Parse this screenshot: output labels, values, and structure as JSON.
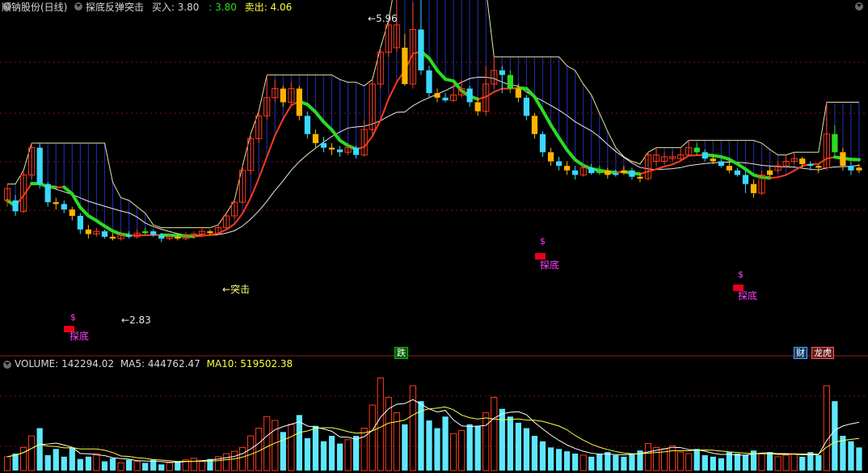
{
  "header": {
    "stock_name": "顺钠股份(日线)",
    "indicator_name": "探底反弹突击",
    "buy_label": "买入:",
    "buy_value": "3.80",
    "buy_value2": ": 3.80",
    "sell_label": "卖出:",
    "sell_value": "4.06"
  },
  "volume_header": {
    "volume_text": "VOLUME: 142294.02",
    "ma5_text": "MA5: 444762.47",
    "ma10_text": "MA10: 519502.38"
  },
  "annotations": {
    "high": "5.96",
    "low": "2.83",
    "breakout": "突击",
    "dip_marker": "$",
    "dip_label": "探底"
  },
  "event_badges": [
    {
      "text": "跌",
      "color": "#00c000"
    },
    {
      "text": "财",
      "color": "#4fa8ff"
    },
    {
      "text": "龙虎",
      "color": "#ff5a5a"
    }
  ],
  "colors": {
    "up": "#ff3a1a",
    "down": "#3ad8ff",
    "yellow_candle": "#ffb400",
    "green_line": "#2adc22",
    "red_line": "#ff3a1a",
    "white_line": "#e8e8e8",
    "band_line": "#e6e6a0",
    "blue_fill": "#1a2aa0",
    "grid": "#7a1a1a",
    "ma5": "#ffffff",
    "ma10": "#ffff40"
  },
  "chart_data": {
    "type": "candlestick",
    "price_range": [
      2.5,
      6.2
    ],
    "candles": [
      [
        4.25,
        4.12,
        4.3,
        4.05,
        "u"
      ],
      [
        4.12,
        4.0,
        4.18,
        3.95,
        "d"
      ],
      [
        4.0,
        4.4,
        4.45,
        3.98,
        "u"
      ],
      [
        4.4,
        4.7,
        4.75,
        4.35,
        "u"
      ],
      [
        4.7,
        4.3,
        4.75,
        4.25,
        "d"
      ],
      [
        4.3,
        4.1,
        4.32,
        4.05,
        "d"
      ],
      [
        4.1,
        4.08,
        4.15,
        4.02,
        "y"
      ],
      [
        4.08,
        4.02,
        4.12,
        3.98,
        "d"
      ],
      [
        4.02,
        3.95,
        4.05,
        3.9,
        "y"
      ],
      [
        3.95,
        3.8,
        3.98,
        3.75,
        "d"
      ],
      [
        3.8,
        3.75,
        3.85,
        3.7,
        "y"
      ],
      [
        3.75,
        3.78,
        3.82,
        3.72,
        "u"
      ],
      [
        3.78,
        3.72,
        3.8,
        3.7,
        "d"
      ],
      [
        3.72,
        3.7,
        3.76,
        3.68,
        "y"
      ],
      [
        3.7,
        3.74,
        3.78,
        3.68,
        "u"
      ],
      [
        3.74,
        3.72,
        3.78,
        3.7,
        "d"
      ],
      [
        3.72,
        3.76,
        3.8,
        3.7,
        "u"
      ],
      [
        3.76,
        3.78,
        3.82,
        3.74,
        "g"
      ],
      [
        3.78,
        3.74,
        3.8,
        3.72,
        "d"
      ],
      [
        3.74,
        3.7,
        3.76,
        3.66,
        "d"
      ],
      [
        3.7,
        3.72,
        3.76,
        3.68,
        "u"
      ],
      [
        3.72,
        3.7,
        3.75,
        3.68,
        "y"
      ],
      [
        3.7,
        3.73,
        3.77,
        3.68,
        "u"
      ],
      [
        3.73,
        3.75,
        3.78,
        3.7,
        "u"
      ],
      [
        3.75,
        3.78,
        3.82,
        3.74,
        "u"
      ],
      [
        3.78,
        3.76,
        3.8,
        3.74,
        "y"
      ],
      [
        3.76,
        3.82,
        3.85,
        3.74,
        "u"
      ],
      [
        3.82,
        3.95,
        3.98,
        3.8,
        "u"
      ],
      [
        3.95,
        4.1,
        4.12,
        3.92,
        "u"
      ],
      [
        4.1,
        4.45,
        4.5,
        4.08,
        "u"
      ],
      [
        4.45,
        4.8,
        4.85,
        4.4,
        "u"
      ],
      [
        4.8,
        5.05,
        5.1,
        4.75,
        "u"
      ],
      [
        5.05,
        5.25,
        5.5,
        5.0,
        "u"
      ],
      [
        5.25,
        5.35,
        5.45,
        5.2,
        "u"
      ],
      [
        5.35,
        5.2,
        5.38,
        5.15,
        "y"
      ],
      [
        5.2,
        5.35,
        5.42,
        5.15,
        "u"
      ],
      [
        5.35,
        5.05,
        5.38,
        5.0,
        "y"
      ],
      [
        5.05,
        4.85,
        5.1,
        4.8,
        "d"
      ],
      [
        4.85,
        4.75,
        4.9,
        4.7,
        "y"
      ],
      [
        4.75,
        4.7,
        4.82,
        4.65,
        "d"
      ],
      [
        4.7,
        4.68,
        4.75,
        4.62,
        "y"
      ],
      [
        4.68,
        4.65,
        4.72,
        4.6,
        "d"
      ],
      [
        4.65,
        4.7,
        4.75,
        4.62,
        "u"
      ],
      [
        4.7,
        4.62,
        4.72,
        4.58,
        "d"
      ],
      [
        4.62,
        4.9,
        5.0,
        4.6,
        "u"
      ],
      [
        4.9,
        5.4,
        5.45,
        4.85,
        "u"
      ],
      [
        5.4,
        5.75,
        5.8,
        5.35,
        "u"
      ],
      [
        5.75,
        6.05,
        6.1,
        5.7,
        "u"
      ],
      [
        6.05,
        5.8,
        6.6,
        5.75,
        "u"
      ],
      [
        5.8,
        5.4,
        5.95,
        5.38,
        "y"
      ],
      [
        5.4,
        6.0,
        6.3,
        5.35,
        "u"
      ],
      [
        6.0,
        5.55,
        6.45,
        5.5,
        "d"
      ],
      [
        5.55,
        5.3,
        5.6,
        5.25,
        "d"
      ],
      [
        5.3,
        5.25,
        5.35,
        5.2,
        "y"
      ],
      [
        5.25,
        5.22,
        5.3,
        5.2,
        "d"
      ],
      [
        5.22,
        5.28,
        5.4,
        5.2,
        "u"
      ],
      [
        5.28,
        5.35,
        5.45,
        5.25,
        "u"
      ],
      [
        5.35,
        5.2,
        5.38,
        5.15,
        "d"
      ],
      [
        5.2,
        5.1,
        5.25,
        5.05,
        "y"
      ],
      [
        5.1,
        5.4,
        5.6,
        5.05,
        "u"
      ],
      [
        5.4,
        5.55,
        5.7,
        5.35,
        "u"
      ],
      [
        5.55,
        5.5,
        5.6,
        5.3,
        "d"
      ],
      [
        5.5,
        5.35,
        5.55,
        5.3,
        "g"
      ],
      [
        5.35,
        5.25,
        5.4,
        5.2,
        "y"
      ],
      [
        5.25,
        5.05,
        5.28,
        5.0,
        "d"
      ],
      [
        5.05,
        4.85,
        5.08,
        4.8,
        "y"
      ],
      [
        4.85,
        4.65,
        4.88,
        4.6,
        "d"
      ],
      [
        4.65,
        4.55,
        4.7,
        4.5,
        "y"
      ],
      [
        4.55,
        4.5,
        4.6,
        4.45,
        "d"
      ],
      [
        4.5,
        4.45,
        4.55,
        4.4,
        "y"
      ],
      [
        4.45,
        4.4,
        4.5,
        4.35,
        "d"
      ],
      [
        4.4,
        4.48,
        4.52,
        4.38,
        "u"
      ],
      [
        4.48,
        4.42,
        4.52,
        4.4,
        "d"
      ],
      [
        4.42,
        4.45,
        4.5,
        4.4,
        "g"
      ],
      [
        4.45,
        4.4,
        4.48,
        4.36,
        "y"
      ],
      [
        4.4,
        4.42,
        4.46,
        4.38,
        "d"
      ],
      [
        4.42,
        4.45,
        4.5,
        4.4,
        "y"
      ],
      [
        4.45,
        4.38,
        4.48,
        4.35,
        "d"
      ],
      [
        4.38,
        4.36,
        4.42,
        4.32,
        "y"
      ],
      [
        4.36,
        4.62,
        4.65,
        4.34,
        "u"
      ],
      [
        4.62,
        4.55,
        4.7,
        4.5,
        "u"
      ],
      [
        4.55,
        4.6,
        4.65,
        4.52,
        "u"
      ],
      [
        4.6,
        4.58,
        4.66,
        4.55,
        "u"
      ],
      [
        4.58,
        4.62,
        4.7,
        4.56,
        "u"
      ],
      [
        4.62,
        4.7,
        4.78,
        4.6,
        "u"
      ],
      [
        4.7,
        4.65,
        4.75,
        4.62,
        "g"
      ],
      [
        4.65,
        4.58,
        4.68,
        4.55,
        "d"
      ],
      [
        4.58,
        4.55,
        4.62,
        4.52,
        "y"
      ],
      [
        4.55,
        4.5,
        4.58,
        4.48,
        "d"
      ],
      [
        4.5,
        4.45,
        4.55,
        4.42,
        "y"
      ],
      [
        4.45,
        4.4,
        4.48,
        4.38,
        "d"
      ],
      [
        4.4,
        4.3,
        4.45,
        4.2,
        "d"
      ],
      [
        4.3,
        4.2,
        4.35,
        4.15,
        "y"
      ],
      [
        4.2,
        4.4,
        4.45,
        4.18,
        "u"
      ],
      [
        4.4,
        4.45,
        4.5,
        4.38,
        "y"
      ],
      [
        4.45,
        4.5,
        4.55,
        4.42,
        "u"
      ],
      [
        4.5,
        4.55,
        4.62,
        4.48,
        "u"
      ],
      [
        4.55,
        4.58,
        4.65,
        4.52,
        "u"
      ],
      [
        4.58,
        4.52,
        4.6,
        4.48,
        "y"
      ],
      [
        4.52,
        4.5,
        4.55,
        4.45,
        "d"
      ],
      [
        4.5,
        4.48,
        4.52,
        4.42,
        "y"
      ],
      [
        4.48,
        4.85,
        5.2,
        4.45,
        "u"
      ],
      [
        4.85,
        4.65,
        4.95,
        4.6,
        "g"
      ],
      [
        4.65,
        4.5,
        4.7,
        4.45,
        "y"
      ],
      [
        4.5,
        4.45,
        4.55,
        4.4,
        "d"
      ],
      [
        4.45,
        4.48,
        4.52,
        4.42,
        "y"
      ]
    ],
    "volume": [
      18,
      22,
      30,
      45,
      55,
      20,
      28,
      18,
      30,
      15,
      18,
      22,
      12,
      16,
      10,
      14,
      12,
      10,
      14,
      8,
      10,
      12,
      14,
      16,
      12,
      15,
      18,
      22,
      25,
      30,
      45,
      55,
      70,
      65,
      50,
      60,
      72,
      42,
      58,
      38,
      45,
      35,
      40,
      45,
      55,
      85,
      120,
      95,
      75,
      60,
      110,
      90,
      65,
      55,
      70,
      48,
      52,
      60,
      58,
      75,
      95,
      80,
      70,
      62,
      55,
      45,
      38,
      30,
      28,
      25,
      22,
      20,
      18,
      22,
      24,
      20,
      18,
      22,
      26,
      35,
      30,
      28,
      32,
      24,
      22,
      28,
      20,
      18,
      16,
      24,
      22,
      20,
      26,
      22,
      24,
      18,
      20,
      22,
      18,
      24,
      20,
      110,
      90,
      45,
      38,
      30
    ],
    "ma5_scale_max": 130
  }
}
